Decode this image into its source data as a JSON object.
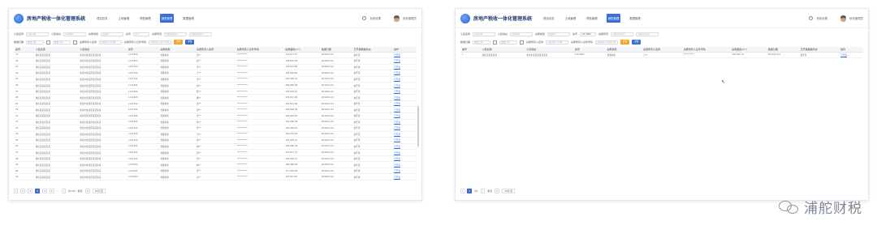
{
  "app": {
    "title": "房地产税收一体化管理系统",
    "nav": [
      "项目总览",
      "土地管理",
      "预售管理",
      "销售管理",
      "数据管理"
    ],
    "active_nav": 3,
    "settings_label": "系统设置",
    "user_label": "系统管理员"
  },
  "filters": {
    "project_name_label": "小区名称",
    "project_name_ph": "小区名称",
    "project_addr_label": "小区地址",
    "project_addr_ph": "小区地址",
    "type_label": "房屋类型",
    "type_value": "请选择",
    "room_label": "房号",
    "room_ph": "房号",
    "room_value_right": "1-6-1802",
    "buyer_label": "房屋所有",
    "buyer_ph": "房屋所有权人",
    "date_label": "数据日期",
    "date_from": "数据日期",
    "date_to": "数据日期",
    "owner_label": "房屋所有人名称",
    "owner_ph": "房屋所有人名称",
    "id_label": "房屋所有人证件号码",
    "id_ph": "房屋所有人证件号码",
    "search_btn": "查询",
    "reset_btn": "重置"
  },
  "table": {
    "columns": [
      "编号",
      "小区名称",
      "小区地址",
      "房号",
      "房屋类型",
      "房屋所有人名称",
      "房屋所有人证件号码",
      "房屋面积(m²)",
      "数据日期",
      "已开票数据状态",
      "操作"
    ],
    "rows_left": [
      [
        "21",
        "重庆某某某某某",
        "重庆市某某区某某某某",
        "1-6-1802",
        "普通住宅",
        "张**",
        "**********",
        "116,077.57",
        "2019-01-01",
        "未开票",
        "已开票"
      ],
      [
        "22",
        "重庆某某某某某",
        "重庆市某某区某某某某",
        "1-6-1803",
        "普通住宅",
        "赵**",
        "**********",
        "128,615.39",
        "2019-01-01",
        "未开票",
        "已开票"
      ],
      [
        "23",
        "重庆某某某某某",
        "重庆市某某区某某某某",
        "1-6-1703",
        "普通住宅",
        "李**",
        "**********",
        "135,615.68",
        "2019-01-01",
        "未开票",
        "已开票"
      ],
      [
        "24",
        "重庆某某某某某",
        "重庆市某某区某某某某",
        "1-6-1702",
        "普通住宅",
        "王**",
        "**********",
        "163,548.56",
        "2019-01-01",
        "未开票",
        "已开票"
      ],
      [
        "25",
        "重庆某某某某某",
        "重庆市某某区某某某某",
        "1-6-1701",
        "普通住宅",
        "李**",
        "**********",
        "150,399.32",
        "2019-01-01",
        "未开票",
        "已开票"
      ],
      [
        "26",
        "重庆某某某某某",
        "重庆市某某区某某某某",
        "1-6-1601",
        "普通住宅",
        "刘**",
        "**********",
        "160,080.56",
        "2019-01-01",
        "未开票",
        "已开票"
      ],
      [
        "27",
        "重庆某某某某某",
        "重庆市某某区某某某某",
        "1-6-1602",
        "普通住宅",
        "陈**",
        "**********",
        "135,548.41",
        "2019-01-01",
        "未开票",
        "已开票"
      ],
      [
        "28",
        "重庆某某某某某",
        "重庆市某某区某某某某",
        "1-6-1603",
        "普通住宅",
        "杨**",
        "**********",
        "170,721.36",
        "2019-01-01",
        "未开票",
        "已开票"
      ],
      [
        "29",
        "重庆某某某某某",
        "重庆市某某区某某某某",
        "1-6-1502",
        "普通住宅",
        "黄**",
        "**********",
        "161,521.09",
        "2019-01-01",
        "未开票",
        "已开票"
      ],
      [
        "30",
        "重庆某某某某某",
        "重庆市某某区某某某某",
        "1-6-1501",
        "普通住宅",
        "周**",
        "**********",
        "150,560.38",
        "2019-01-01",
        "未开票",
        "已开票"
      ],
      [
        "31",
        "重庆某某某某某",
        "重庆市某某区某某某某",
        "1-6-1402",
        "普通住宅",
        "吴**",
        "**********",
        "145,625.52",
        "2019-01-01",
        "未开票",
        "已开票"
      ],
      [
        "32",
        "重庆某某某某某",
        "重庆市某某区某某某某",
        "1-6-1401",
        "普通住宅",
        "徐**",
        "**********",
        "153,290.38",
        "2019-01-01",
        "未开票",
        "已开票"
      ],
      [
        "33",
        "重庆某某某某某",
        "重庆市某某区某某某某",
        "1-6-1301",
        "普通住宅",
        "孙**",
        "**********",
        "164,785.02",
        "2019-01-01",
        "未开票",
        "已开票"
      ],
      [
        "34",
        "重庆某某某某某",
        "重庆市某某区某某某某",
        "1-6-1302",
        "普通住宅",
        "马**",
        "**********",
        "164,379.05",
        "2019-01-01",
        "未开票",
        "已开票"
      ],
      [
        "35",
        "重庆某某某某某",
        "重庆市某某区某某某某",
        "1-6-1202",
        "普通住宅",
        "朱**",
        "**********",
        "163,295.12",
        "2019-01-01",
        "未开票",
        "已开票"
      ],
      [
        "36",
        "重庆某某某某某",
        "重庆市某某区某某某某",
        "1-6-1201",
        "普通住宅",
        "胡**",
        "**********",
        "150,560.38",
        "2019-01-01",
        "未开票",
        "已开票"
      ],
      [
        "37",
        "重庆某某某某某",
        "重庆市某某区某某某某",
        "1-6-1101",
        "普通住宅",
        "郭**",
        "**********",
        "151,521.73",
        "2019-01-01",
        "未开票",
        "已开票"
      ],
      [
        "38",
        "重庆某某某某某",
        "重庆市某某区某某某某",
        "1-6-1102",
        "普通住宅",
        "何**",
        "**********",
        "135,548.41",
        "2019-01-01",
        "未开票",
        "已开票"
      ],
      [
        "39",
        "重庆某某某某某",
        "重庆市某某区某某某某",
        "1-6-1002",
        "普通住宅",
        "林**",
        "**********",
        "160,080.56",
        "2019-01-01",
        "未开票",
        "已开票"
      ],
      [
        "40",
        "重庆某某某某某",
        "重庆市某某区某某某某",
        "1-6-1001",
        "普通住宅",
        "罗**",
        "**********",
        "177,220.90",
        "2019-01-01",
        "未开票",
        "已开票"
      ],
      [
        "41",
        "重庆某某某某某",
        "重庆市某某区某某某某",
        "1-6-1003",
        "普通住宅",
        "高**",
        "**********",
        "161,521.50",
        "2019-01-01",
        "未开票",
        "已开票"
      ]
    ],
    "rows_right": [
      [
        "1",
        "重庆某某某某某",
        "重庆市某某区某某某某",
        "1-6-1802",
        "普通住宅",
        "王**",
        "**********",
        "700,497.12",
        "2019-01-01",
        "未开票",
        "已开票"
      ]
    ]
  },
  "pager_left": {
    "prev": "‹",
    "pages": [
      "1",
      "2",
      "3",
      "4",
      "5"
    ],
    "active": "3",
    "ellipsis": "…",
    "next": "›",
    "total": "共100",
    "jump_label": "跳至",
    "jump_value": "3",
    "size_value": "20条/页"
  },
  "pager_right": {
    "prev": "‹",
    "pages": [
      "1"
    ],
    "active": "1",
    "total": "共1",
    "next": "›",
    "jump_label": "跳至",
    "jump_value": "1",
    "size_value": "20条/页"
  },
  "watermark": "浦舵财税"
}
